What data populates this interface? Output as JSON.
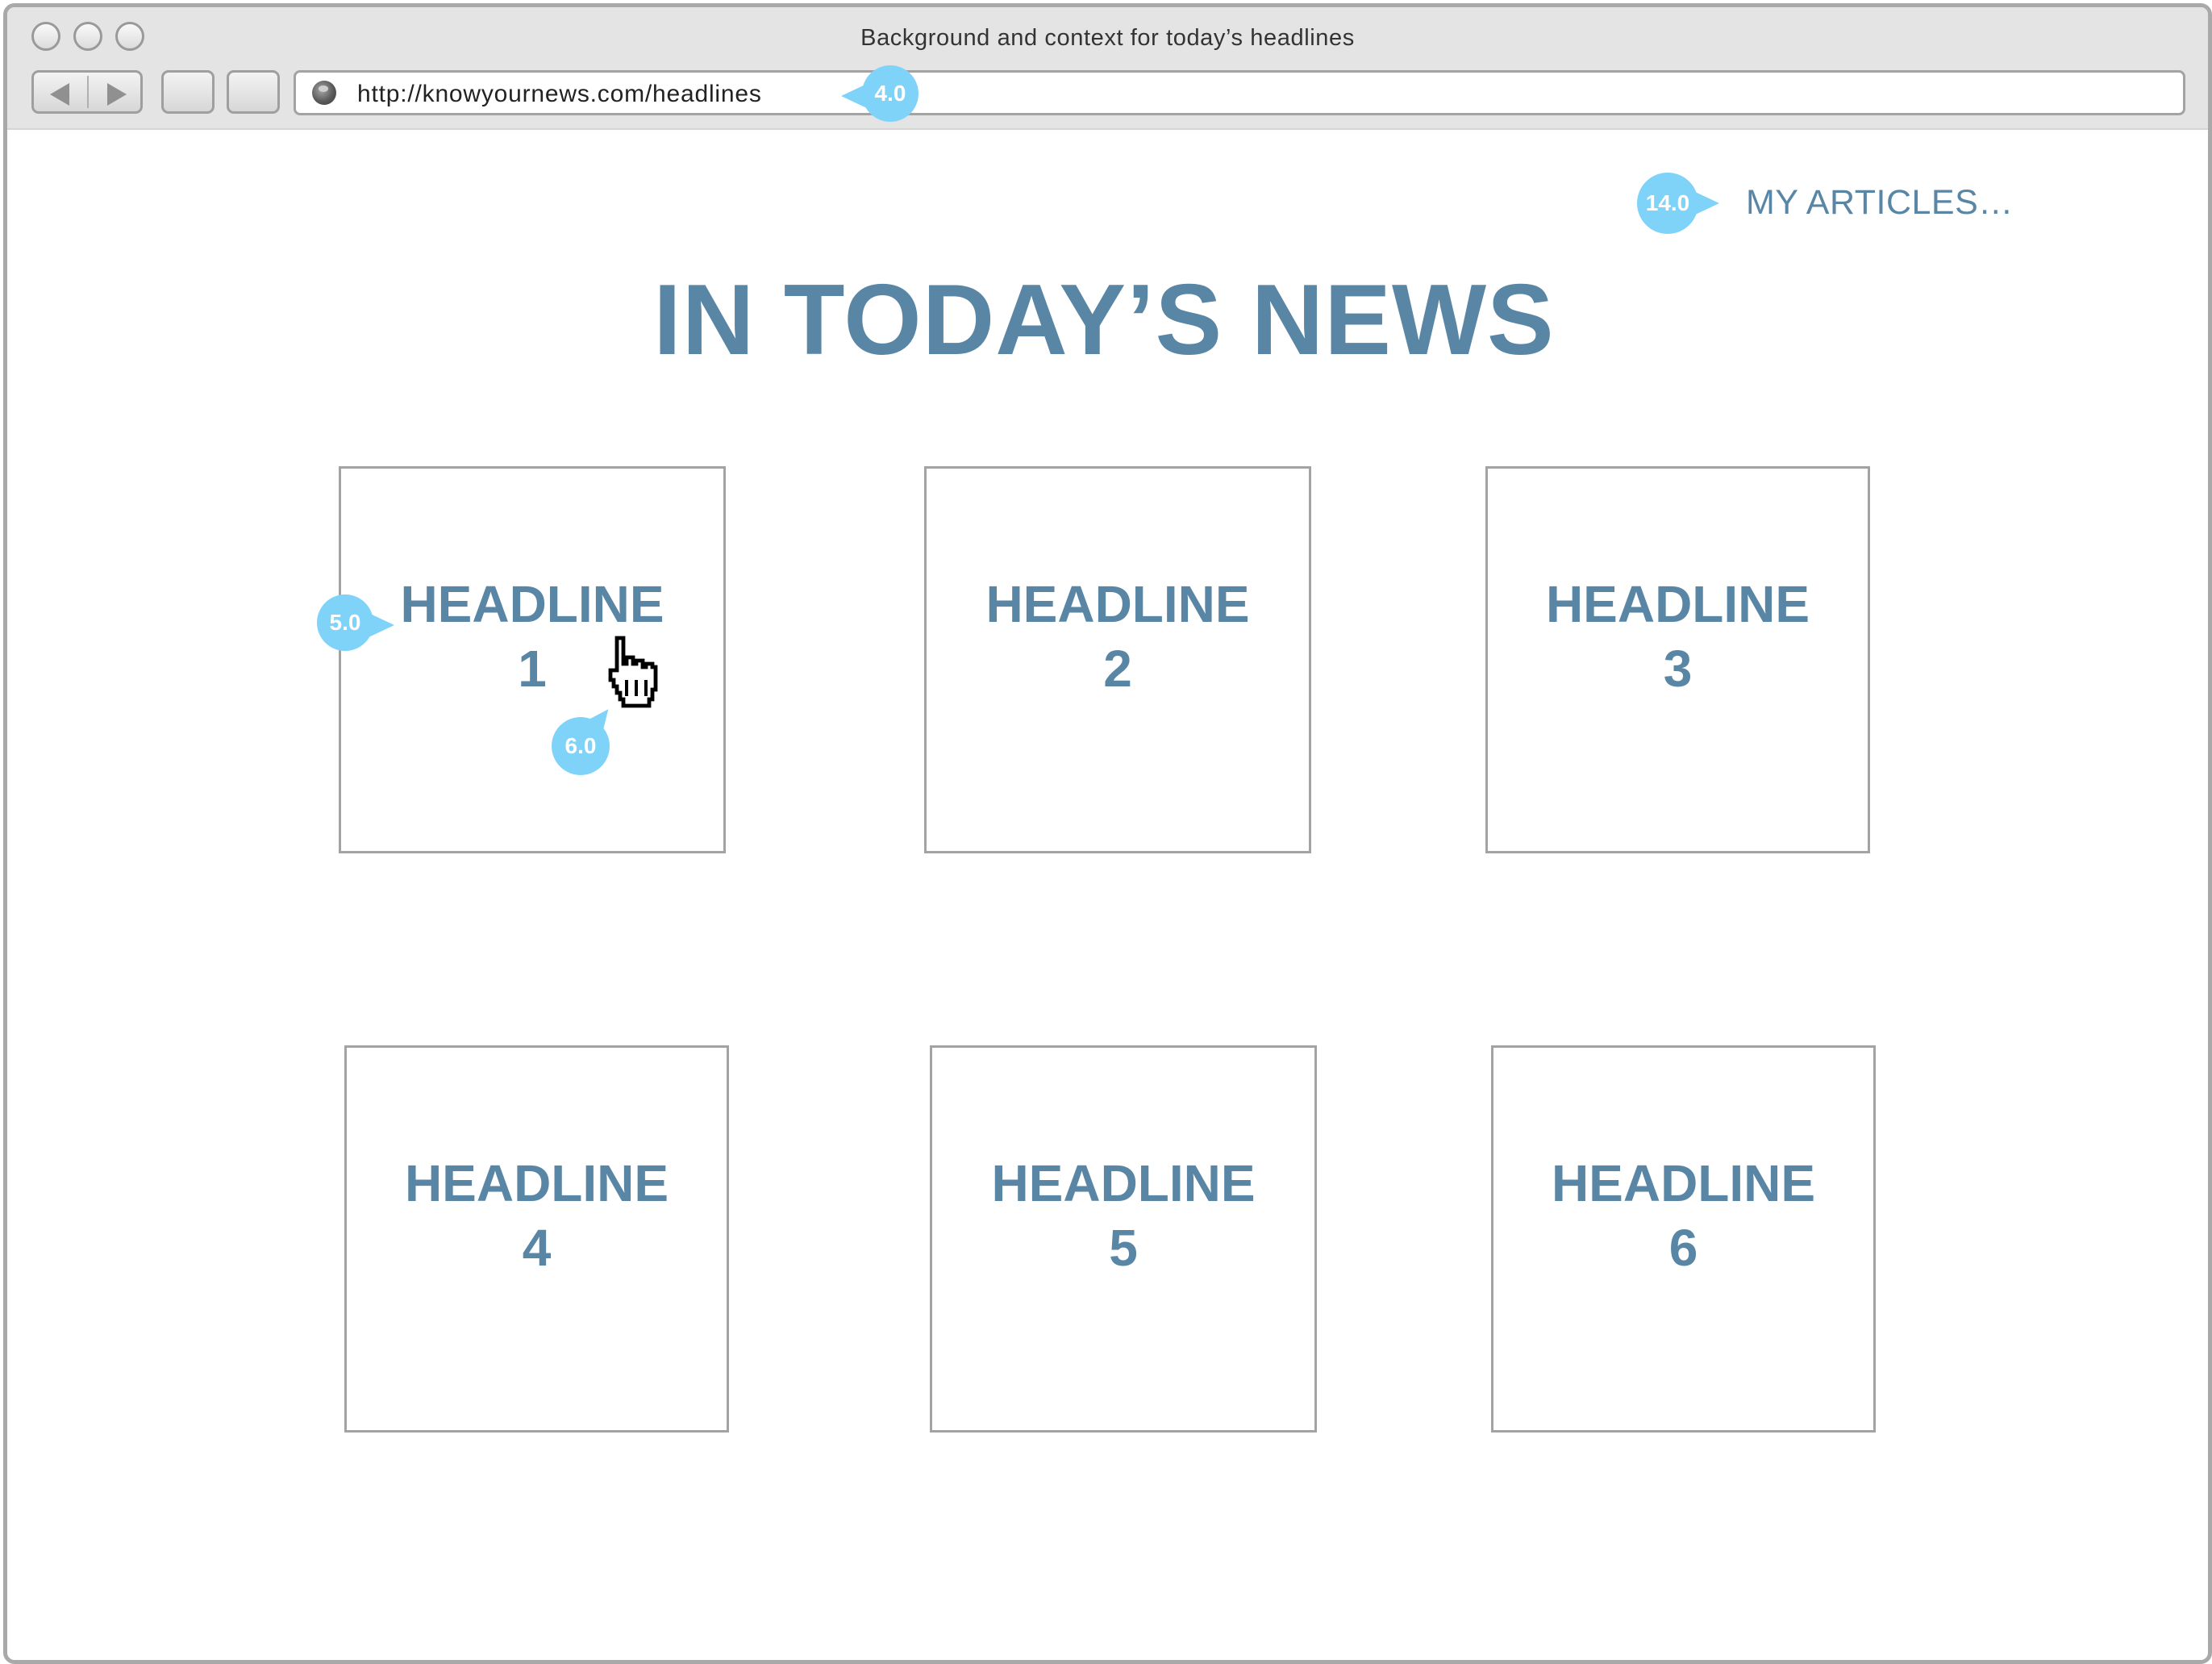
{
  "window": {
    "title": "Background and context for today’s headlines"
  },
  "address_bar": {
    "url": "http://knowyournews.com/headlines"
  },
  "annotations": {
    "url": "4.0",
    "headline1": "5.0",
    "cursor": "6.0",
    "my_articles": "14.0"
  },
  "nav": {
    "my_articles": "MY ARTICLES…"
  },
  "page": {
    "title": "IN TODAY’S NEWS"
  },
  "headlines": [
    {
      "label": "HEADLINE",
      "number": "1"
    },
    {
      "label": "HEADLINE",
      "number": "2"
    },
    {
      "label": "HEADLINE",
      "number": "3"
    },
    {
      "label": "HEADLINE",
      "number": "4"
    },
    {
      "label": "HEADLINE",
      "number": "5"
    },
    {
      "label": "HEADLINE",
      "number": "6"
    }
  ],
  "colors": {
    "accent": "#5a86a6",
    "annotation": "#7fd3f8",
    "chrome": "#e4e4e4",
    "border": "#a3a3a3"
  },
  "icons": {
    "back": "back-arrow-icon",
    "forward": "forward-arrow-icon",
    "site": "globe-icon",
    "pointer": "hand-pointer-icon"
  }
}
